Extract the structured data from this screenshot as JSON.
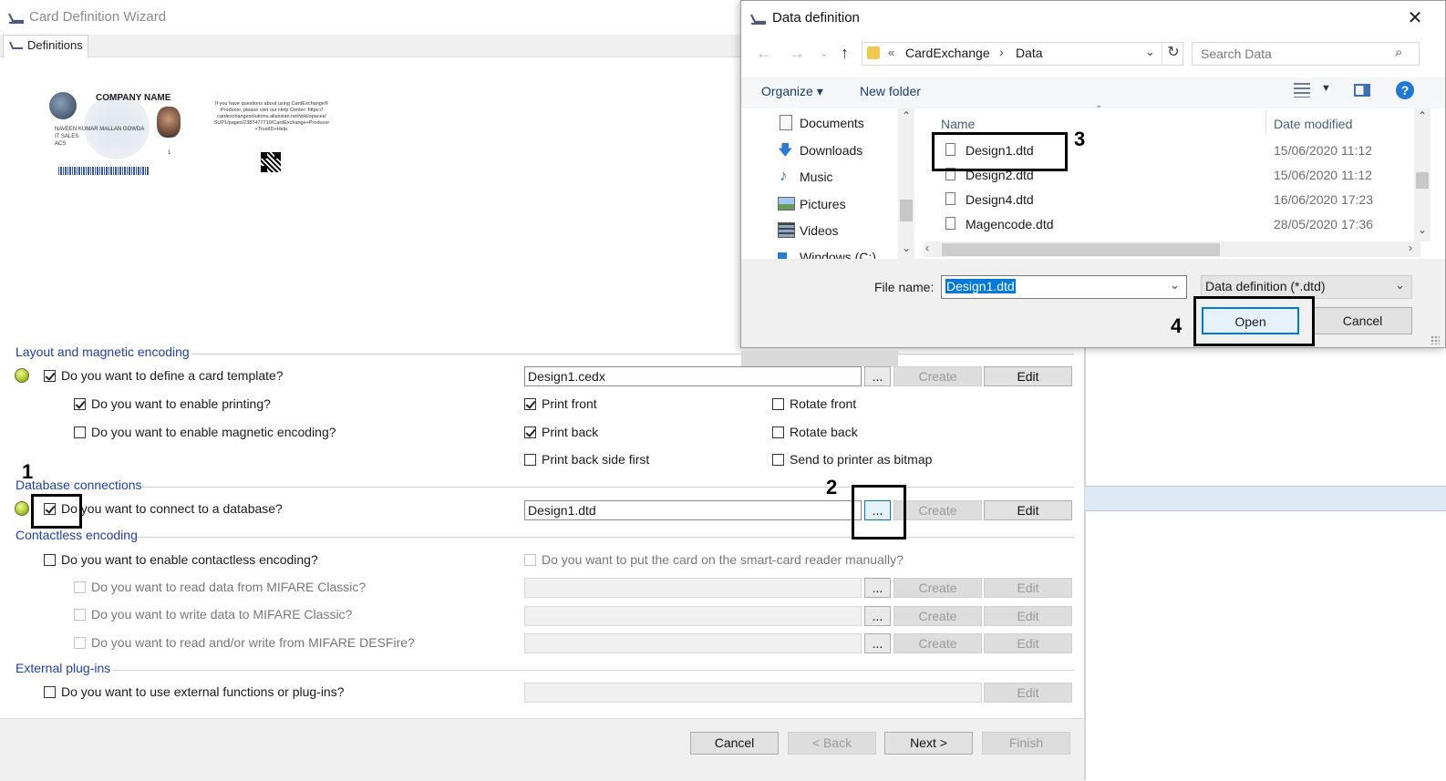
{
  "wizard": {
    "title": "Card Definition Wizard",
    "tab": "Definitions",
    "card_preview": {
      "company_name": "COMPANY NAME",
      "person_name": "NAVEEN KUMAR MALLAN GOWDA",
      "department": "IT SALES",
      "company_short": "ACS",
      "number": "1",
      "help_text": "If you have questions about using CardExchange® Producer, please visit our Help Center: https:// cardexchangesolutions.atlassian.net/wiki/spaces/ SUP1/pages/2387477710/CardExchange+Producer +TrustID+Help."
    },
    "sections": {
      "layout": {
        "title": "Layout and magnetic encoding",
        "define_template": {
          "label": "Do you want to define a card template?",
          "checked": true,
          "value": "Design1.cedx"
        },
        "enable_printing": {
          "label": "Do you want to enable printing?",
          "checked": true
        },
        "enable_magnetic": {
          "label": "Do you want to enable magnetic encoding?",
          "checked": false
        },
        "print_front": {
          "label": "Print front",
          "checked": true
        },
        "print_back": {
          "label": "Print back",
          "checked": true
        },
        "print_back_first": {
          "label": "Print back side first",
          "checked": false
        },
        "rotate_front": {
          "label": "Rotate front",
          "checked": false
        },
        "rotate_back": {
          "label": "Rotate back",
          "checked": false
        },
        "send_bitmap": {
          "label": "Send to printer as bitmap",
          "checked": false
        }
      },
      "database": {
        "title": "Database connections",
        "connect": {
          "label": "Do you want to connect to a database?",
          "checked": true,
          "value": "Design1.dtd"
        }
      },
      "contactless": {
        "title": "Contactless encoding",
        "enable": {
          "label": "Do you want to enable contactless encoding?",
          "checked": false
        },
        "manual": {
          "label": "Do you want to put the card on the smart-card reader manually?",
          "checked": false
        },
        "read_mifare": {
          "label": "Do you want to read data from MIFARE Classic?"
        },
        "write_mifare": {
          "label": "Do you want to write data to MIFARE Classic?"
        },
        "desfire": {
          "label": "Do you want to read and/or write from MIFARE DESFire?"
        }
      },
      "external": {
        "title": "External plug-ins",
        "use": {
          "label": "Do you want to use external functions or plug-ins?",
          "checked": false
        }
      }
    },
    "buttons": {
      "browse": "...",
      "create": "Create",
      "edit": "Edit",
      "cancel": "Cancel",
      "back": "< Back",
      "next": "Next >",
      "finish": "Finish"
    }
  },
  "dialog": {
    "title": "Data definition",
    "close": "✕",
    "breadcrumb": {
      "prefix": "«",
      "parts": [
        "CardExchange",
        "Data"
      ],
      "sep": "›"
    },
    "search_placeholder": "Search Data",
    "toolbar": {
      "organize": "Organize ▾",
      "new_folder": "New folder",
      "help": "?"
    },
    "nav_items": [
      "Documents",
      "Downloads",
      "Music",
      "Pictures",
      "Videos",
      "Windows (C:)"
    ],
    "columns": {
      "name": "Name",
      "date": "Date modified"
    },
    "files": [
      {
        "name": "Design1.dtd",
        "date": "15/06/2020 11:12"
      },
      {
        "name": "Design2.dtd",
        "date": "15/06/2020 11:12"
      },
      {
        "name": "Design4.dtd",
        "date": "16/06/2020 17:23"
      },
      {
        "name": "Magencode.dtd",
        "date": "28/05/2020 17:36"
      }
    ],
    "file_name_label": "File name:",
    "file_name_value": "Design1.dtd",
    "file_type": "Data definition (*.dtd)",
    "open": "Open",
    "cancel": "Cancel"
  },
  "annotations": [
    "1",
    "2",
    "3",
    "4"
  ]
}
